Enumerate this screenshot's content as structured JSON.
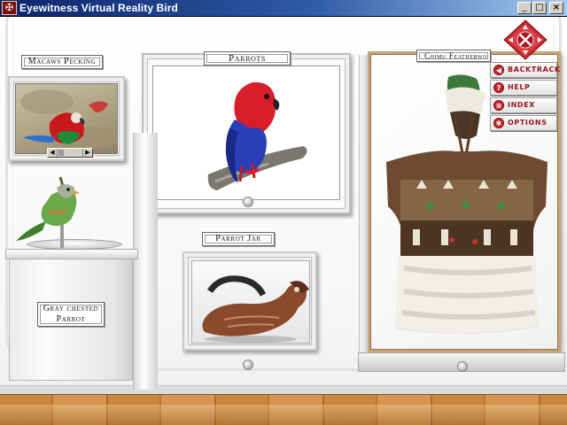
{
  "window": {
    "title": "Eyewitness Virtual Reality Bird",
    "icon": "app-icon",
    "controls": {
      "minimize": "_",
      "maximize": "□",
      "close": "×"
    }
  },
  "exhibits": {
    "macaws": {
      "label": "Macaws Pecking"
    },
    "parrots": {
      "label": "Parrots"
    },
    "parrot_jar": {
      "label": "Parrot Jar"
    },
    "chimu": {
      "label": "Chimu Featherwo"
    },
    "gray_chested": {
      "label_line1": "Gray chested",
      "label_line2": "Parrot"
    }
  },
  "nav": {
    "items": [
      {
        "label": "BACKTRACK",
        "icon": "back-arrow-icon",
        "glyph": "◀"
      },
      {
        "label": "HELP",
        "icon": "help-icon",
        "glyph": "?"
      },
      {
        "label": "INDEX",
        "icon": "index-icon",
        "glyph": "≡"
      },
      {
        "label": "OPTIONS",
        "icon": "options-icon",
        "glyph": "✱"
      }
    ],
    "compass_icon": "compass-icon"
  },
  "colors": {
    "title_bar": "#0a246a",
    "nav_accent": "#c8282f",
    "showcase_frame": "#c4a777",
    "floor": "#c8873f"
  }
}
